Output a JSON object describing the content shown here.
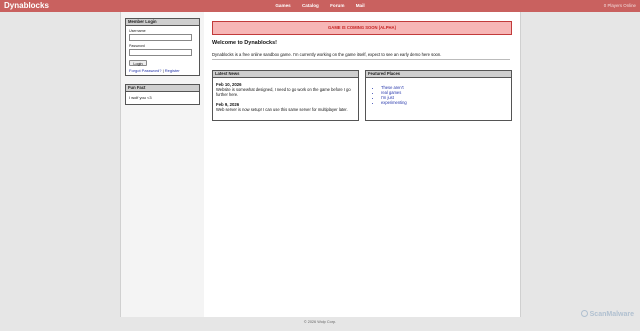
{
  "header": {
    "logo": "Dynablocks",
    "nav": [
      "Games",
      "Catalog",
      "Forum",
      "Mail"
    ],
    "players_online": "0 Players Online"
  },
  "sidebar": {
    "login": {
      "title": "Member Login",
      "username_label": "Username",
      "password_label": "Password",
      "login_button": "Login",
      "forgot_link": "Forgot Password?",
      "separator": "|",
      "register_link": "Register"
    },
    "funfact": {
      "title": "Fun Fact",
      "text": "I wolf you <3"
    }
  },
  "main": {
    "alert": "GAME IS COMING SOON (ALPHA)",
    "welcome_title": "Welcome to Dynablocks!",
    "welcome_text": "Dynablocks is a free online sandbox game. I'm currently working on the game itself, expect to see an early demo here soon.",
    "news": {
      "title": "Latest News",
      "items": [
        {
          "date": "Feb 10, 2026",
          "text": "Website is somewhat designed, I need to go work on the game before I go further here."
        },
        {
          "date": "Feb 9, 2026",
          "text": "Web server is now setup! I can use this same server for multiplayer later."
        }
      ]
    },
    "places": {
      "title": "Featured Places",
      "items": [
        "These aren't",
        "real games",
        "I'm just",
        "experimenting"
      ]
    }
  },
  "footer": {
    "text": "© 2026 Wolp Corp."
  },
  "watermark": {
    "text": "ScanMalware"
  },
  "colors": {
    "header": "#c9615f",
    "alert_bg": "#f7b6b6",
    "alert_text": "#c42323",
    "link": "#2233aa"
  }
}
